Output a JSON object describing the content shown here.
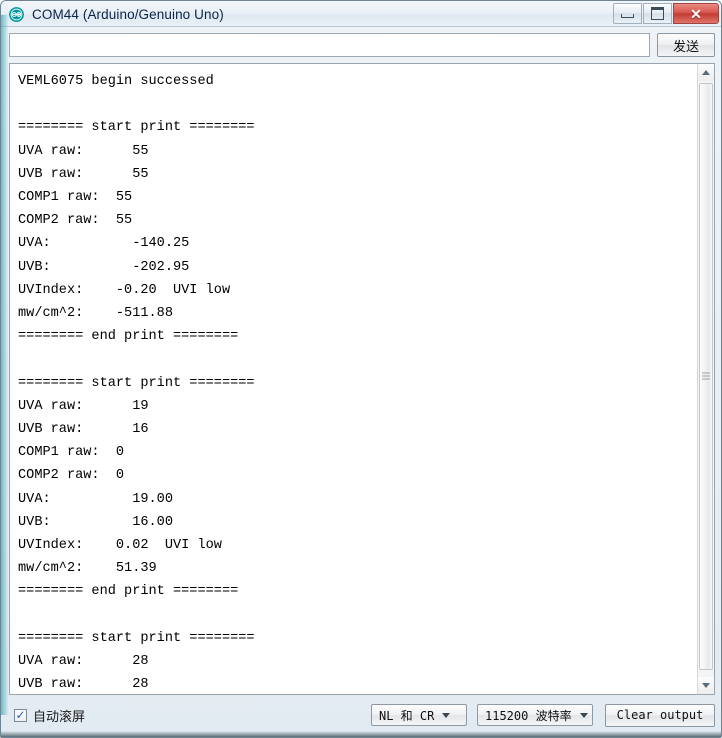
{
  "window": {
    "title": "COM44 (Arduino/Genuino Uno)",
    "logo_icon": "arduino-infinity-icon",
    "controls": {
      "minimize": "—",
      "maximize": "□",
      "close": "✕"
    }
  },
  "send_row": {
    "input_value": "",
    "input_placeholder": "",
    "send_label": "发送"
  },
  "output": {
    "text": "VEML6075 begin successed\n\n======== start print ========\nUVA raw:      55\nUVB raw:      55\nCOMP1 raw:  55\nCOMP2 raw:  55\nUVA:          -140.25\nUVB:          -202.95\nUVIndex:    -0.20  UVI low\nmw/cm^2:    -511.88\n======== end print ========\n\n======== start print ========\nUVA raw:      19\nUVB raw:      16\nCOMP1 raw:  0\nCOMP2 raw:  0\nUVA:          19.00\nUVB:          16.00\nUVIndex:    0.02  UVI low\nmw/cm^2:    51.39\n======== end print ========\n\n======== start print ========\nUVA raw:      28\nUVB raw:      28",
    "scrollbar": {
      "up_arrow": "▲",
      "down_arrow": "▼"
    }
  },
  "statusbar": {
    "autoscroll_label": "自动滚屏",
    "autoscroll_checked": true,
    "check_glyph": "✓",
    "line_ending": "NL 和 CR",
    "baud_rate": "115200 波特率",
    "clear_output_label": "Clear output"
  }
}
